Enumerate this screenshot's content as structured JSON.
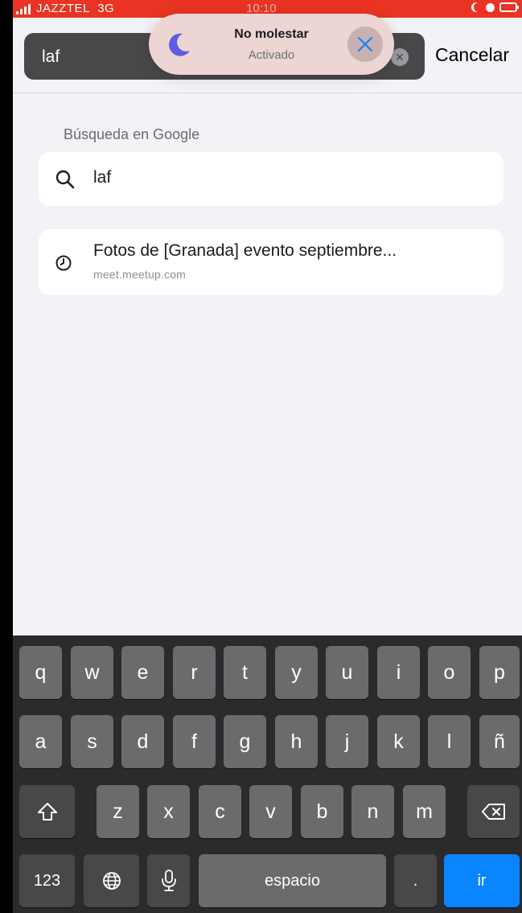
{
  "status": {
    "carrier": "JAZZTEL",
    "network": "3G",
    "time": "10:10"
  },
  "search": {
    "value": "laf",
    "cancel_label": "Cancelar"
  },
  "dnd_banner": {
    "title": "No molestar",
    "subtitle": "Activado"
  },
  "suggestions": {
    "section_title": "Búsqueda en Google",
    "query": "laf",
    "history": {
      "title": "Fotos de [Granada] evento septiembre...",
      "url": "meet.meetup.com"
    }
  },
  "keyboard": {
    "row1": [
      "q",
      "w",
      "e",
      "r",
      "t",
      "y",
      "u",
      "i",
      "o",
      "p"
    ],
    "row2": [
      "a",
      "s",
      "d",
      "f",
      "g",
      "h",
      "j",
      "k",
      "l",
      "ñ"
    ],
    "row3": [
      "z",
      "x",
      "c",
      "v",
      "b",
      "n",
      "m"
    ],
    "numbers_label": "123",
    "space_label": "espacio",
    "period_label": ".",
    "go_label": "ir",
    "accent_color": "#0a84ff"
  },
  "icons": [
    "signal-icon",
    "moon-icon",
    "alarm-icon",
    "battery-icon",
    "clear-icon",
    "close-icon",
    "search-icon",
    "clock-icon",
    "shift-icon",
    "globe-icon",
    "microphone-icon",
    "delete-icon"
  ]
}
